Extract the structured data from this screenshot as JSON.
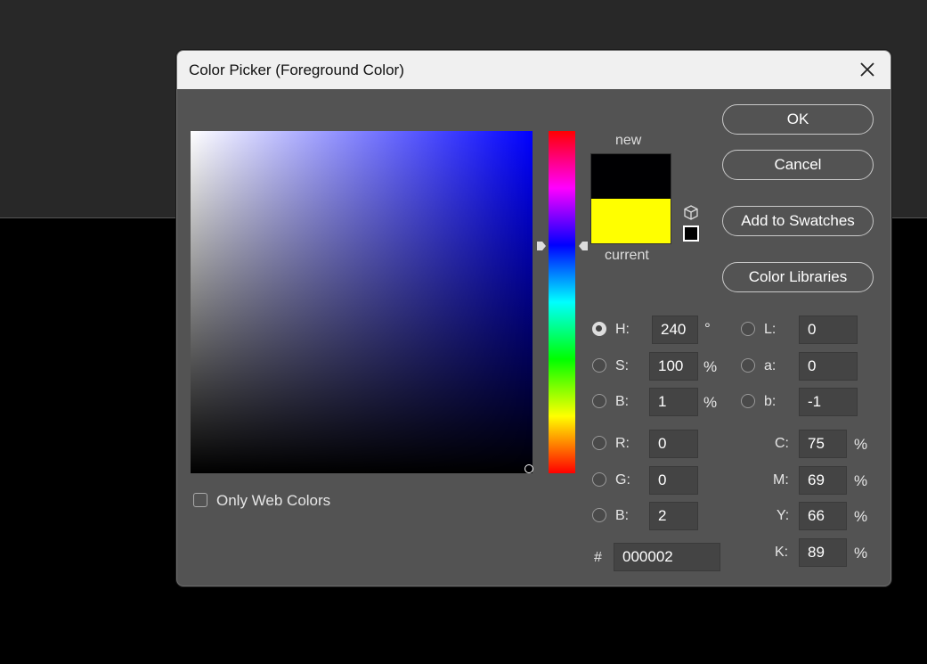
{
  "dialog": {
    "title": "Color Picker (Foreground Color)"
  },
  "swatches": {
    "new_label": "new",
    "current_label": "current",
    "new_color": "#000002",
    "current_color": "#ffff00"
  },
  "buttons": {
    "ok": "OK",
    "cancel": "Cancel",
    "add_to_swatches": "Add to Swatches",
    "color_libraries": "Color Libraries"
  },
  "hsb": {
    "h_label": "H:",
    "h_value": "240",
    "h_unit": "°",
    "s_label": "S:",
    "s_value": "100",
    "s_unit": "%",
    "b_label": "B:",
    "b_value": "1",
    "b_unit": "%",
    "selected": "H"
  },
  "rgb": {
    "r_label": "R:",
    "r_value": "0",
    "g_label": "G:",
    "g_value": "0",
    "b_label": "B:",
    "b_value": "2"
  },
  "lab": {
    "l_label": "L:",
    "l_value": "0",
    "a_label": "a:",
    "a_value": "0",
    "b_label": "b:",
    "b_value": "-1"
  },
  "cmyk": {
    "c_label": "C:",
    "c_value": "75",
    "c_unit": "%",
    "m_label": "M:",
    "m_value": "69",
    "m_unit": "%",
    "y_label": "Y:",
    "y_value": "66",
    "y_unit": "%",
    "k_label": "K:",
    "k_value": "89",
    "k_unit": "%"
  },
  "hex": {
    "label": "#",
    "value": "000002"
  },
  "options": {
    "only_web_colors": "Only Web Colors",
    "only_web_colors_checked": false
  },
  "icons": {
    "close": "close-icon",
    "cube": "cube-icon",
    "hue_arrows": "triangle-arrow-icon"
  }
}
